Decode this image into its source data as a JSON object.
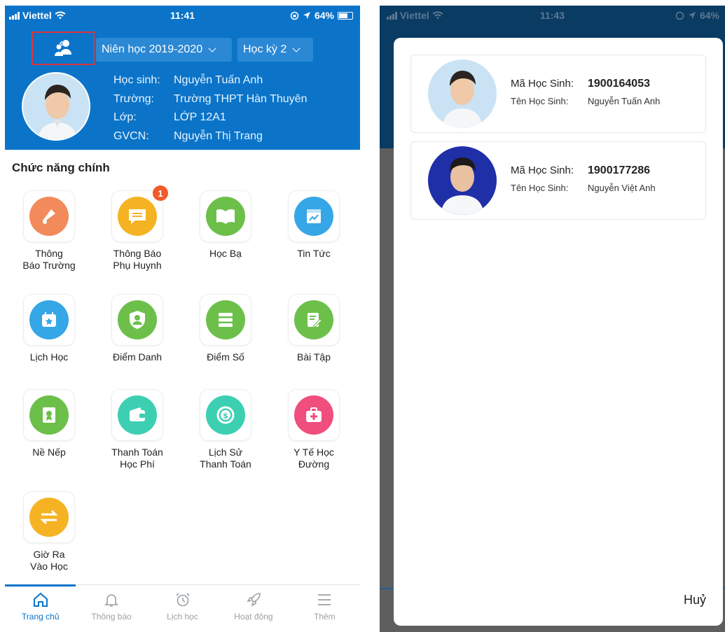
{
  "left": {
    "status": {
      "carrier": "Viettel",
      "time": "11:41",
      "battery": "64%"
    },
    "year_dropdown": "Niên học 2019-2020",
    "term_dropdown": "Học kỳ 2",
    "student_info": [
      {
        "label": "Học sinh:",
        "value": "Nguyễn Tuấn Anh"
      },
      {
        "label": "Trường:",
        "value": "Trường THPT  Hàn Thuyên"
      },
      {
        "label": "Lớp:",
        "value": "LỚP 12A1"
      },
      {
        "label": "GVCN:",
        "value": "Nguyễn Thị Trang"
      }
    ],
    "section_title": "Chức năng chính",
    "tiles": [
      {
        "line1": "Thông",
        "line2": "Báo Trường",
        "color": "#f28a5c",
        "icon": "megaphone-icon"
      },
      {
        "line1": "Thông Báo",
        "line2": "Phụ Huynh",
        "color": "#f5b323",
        "icon": "chat-icon",
        "badge": "1"
      },
      {
        "line1": "Học Bạ",
        "line2": "",
        "color": "#6cc04a",
        "icon": "book-icon"
      },
      {
        "line1": "Tin Tức",
        "line2": "",
        "color": "#35a6e6",
        "icon": "news-icon"
      },
      {
        "line1": "Lịch Học",
        "line2": "",
        "color": "#35a6e6",
        "icon": "calendar-icon"
      },
      {
        "line1": "Điểm Danh",
        "line2": "",
        "color": "#6cc04a",
        "icon": "shield-user-icon"
      },
      {
        "line1": "Điểm Số",
        "line2": "",
        "color": "#6cc04a",
        "icon": "stack-icon"
      },
      {
        "line1": "Bài Tập",
        "line2": "",
        "color": "#6cc04a",
        "icon": "edit-icon"
      },
      {
        "line1": "Nề Nếp",
        "line2": "",
        "color": "#6cc04a",
        "icon": "certificate-icon"
      },
      {
        "line1": "Thanh Toán",
        "line2": "Học Phí",
        "color": "#3ccfb2",
        "icon": "wallet-icon"
      },
      {
        "line1": "Lịch Sử",
        "line2": "Thanh Toán",
        "color": "#3ccfb2",
        "icon": "money-history-icon"
      },
      {
        "line1": "Y Tế Học",
        "line2": "Đường",
        "color": "#f04e7c",
        "icon": "medical-kit-icon"
      },
      {
        "line1": "Giờ Ra",
        "line2": "Vào Học",
        "color": "#f5b323",
        "icon": "swap-arrows-icon"
      }
    ],
    "tabs": [
      {
        "label": "Trang chủ",
        "icon": "home-icon"
      },
      {
        "label": "Thông báo",
        "icon": "bell-icon"
      },
      {
        "label": "Lịch học",
        "icon": "alarm-clock-icon"
      },
      {
        "label": "Hoạt động",
        "icon": "rocket-icon"
      },
      {
        "label": "Thêm",
        "icon": "menu-icon"
      }
    ],
    "active_tab": 0
  },
  "right": {
    "status": {
      "carrier": "Viettel",
      "time": "11:43",
      "battery": "64%"
    },
    "students": [
      {
        "id_label": "Mã Học Sinh:",
        "id": "1900164053",
        "name_label": "Tên Học Sinh:",
        "name": "Nguyễn Tuấn Anh"
      },
      {
        "id_label": "Mã Học Sinh:",
        "id": "1900177286",
        "name_label": "Tên Học Sinh:",
        "name": "Nguyễn Việt Anh"
      }
    ],
    "cancel_label": "Huỷ"
  },
  "colors": {
    "primary": "#0b74c9",
    "badge": "#f05a28",
    "highlight_border": "#e0323a"
  }
}
